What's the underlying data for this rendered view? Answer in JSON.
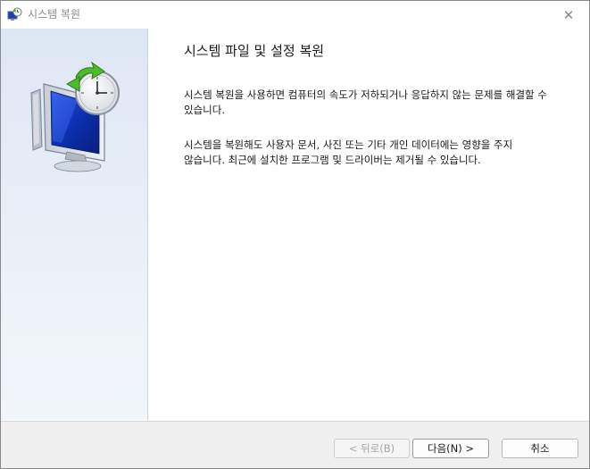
{
  "window": {
    "title": "시스템 복원",
    "close_glyph": "✕"
  },
  "content": {
    "heading": "시스템 파일 및 설정 복원",
    "paragraph1": "시스템 복원을 사용하면 컴퓨터의 속도가 저하되거나 응답하지 않는 문제를 해결할 수 있습니다.",
    "paragraph2": "시스템을 복원해도 사용자 문서, 사진 또는 기타 개인 데이터에는 영향을 주지 않습니다. 최근에 설치한 프로그램 및 드라이버는 제거될 수 있습니다."
  },
  "buttons": {
    "back": "< 뒤로(B)",
    "next": "다음(N) >",
    "cancel": "취소"
  },
  "icons": {
    "title": "system-restore-icon",
    "side": "system-restore-monitor-clock-icon",
    "close": "close-icon"
  },
  "colors": {
    "side_panel": "#dde7f4",
    "footer": "#f0f0f0",
    "disabled_text": "#a6a6a6"
  }
}
